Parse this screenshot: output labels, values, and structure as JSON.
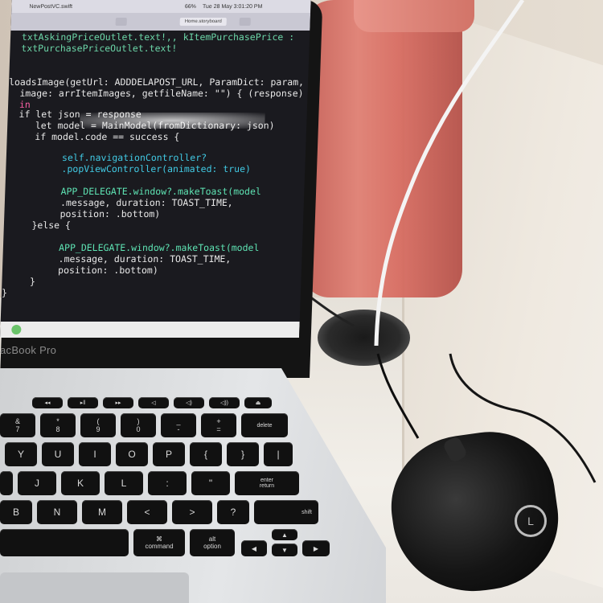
{
  "menubar": {
    "file_title": "NewPostVC.swift",
    "battery": "66%",
    "clock": "Tue 28 May  3:01:20 PM"
  },
  "tabs": {
    "storyboard": "Home.storyboard"
  },
  "code_lines": [
    "  txtAskingPriceOutlet.text!,",
    "  txtPurchasePriceOutlet.text!",
    "loadsImage(getUrl: ADDDELAPOST_URL, ParamDict: param,",
    "  image: arrItemImages, getfileName: \"\") { (response)",
    "  in",
    "  if let json = response",
    "     let model = MainModel(fromDictionary: json)",
    "     if model.code == success {",
    "",
    "          self.navigationController?",
    "          .popViewController(animated: true)",
    "",
    "          APP_DELEGATE.window?.makeToast(model",
    "          .message, duration: TOAST_TIME,",
    "          position: .bottom)",
    "     }else {",
    "",
    "          APP_DELEGATE.window?.makeToast(model",
    "          .message, duration: TOAST_TIME,",
    "          position: .bottom)",
    "     }",
    "}"
  ],
  "line1_suffix": ", kItemPurchasePrice :",
  "brand": "acBook Pro",
  "keys": {
    "delete": "delete",
    "return": "return",
    "enter": "enter",
    "shift": "shift",
    "command": "command",
    "option": "option",
    "alt": "alt",
    "row_num": [
      "&",
      "*",
      "(",
      ")",
      "_",
      "+"
    ],
    "row_num_sub": [
      "7",
      "8",
      "9",
      "0",
      "-",
      "="
    ],
    "row_top": [
      "Y",
      "U",
      "I",
      "O",
      "P",
      "{",
      "}",
      "|"
    ],
    "row_mid": [
      "J",
      "K",
      "L",
      ":",
      "\""
    ],
    "row_bot": [
      "B",
      "N",
      "M",
      "<",
      ">",
      "?"
    ]
  },
  "mouse_logo": "L"
}
